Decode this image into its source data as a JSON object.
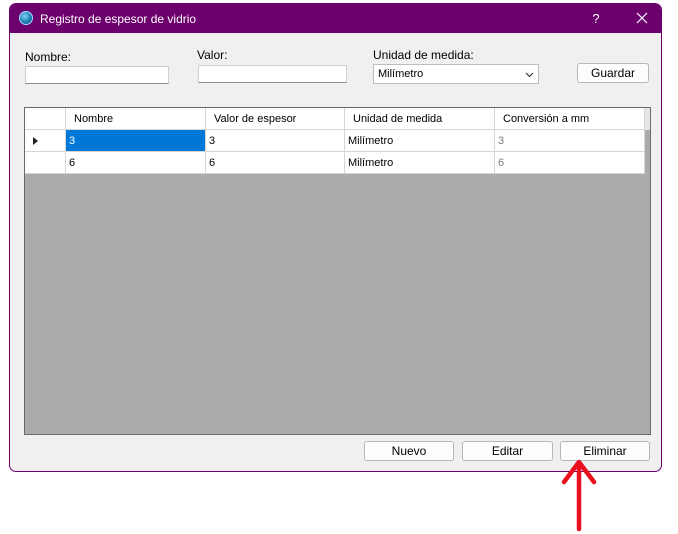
{
  "window": {
    "title": "Registro de espesor de vidrio",
    "help_label": "?",
    "accent_color": "#6c006c"
  },
  "form": {
    "nombre_label": "Nombre:",
    "nombre_value": "",
    "valor_label": "Valor:",
    "valor_value": "",
    "unidad_label": "Unidad de medida:",
    "unidad_value": "Milímetro",
    "guardar_label": "Guardar"
  },
  "table": {
    "columns": [
      "Nombre",
      "Valor de espesor",
      "Unidad de medida",
      "Conversión a mm"
    ],
    "rows": [
      [
        "3",
        "3",
        "Milímetro",
        "3"
      ],
      [
        "6",
        "6",
        "Milímetro",
        "6"
      ]
    ],
    "current_row": 0
  },
  "actions": {
    "nuevo_label": "Nuevo",
    "editar_label": "Editar",
    "eliminar_label": "Eliminar"
  },
  "annotation": {
    "arrow_color": "#e8101e",
    "arrow_target": "eliminar-button"
  },
  "icons": [
    "app-globe-icon",
    "close-icon",
    "chevron-down-icon",
    "row-indicator-icon",
    "red-arrow-icon"
  ]
}
